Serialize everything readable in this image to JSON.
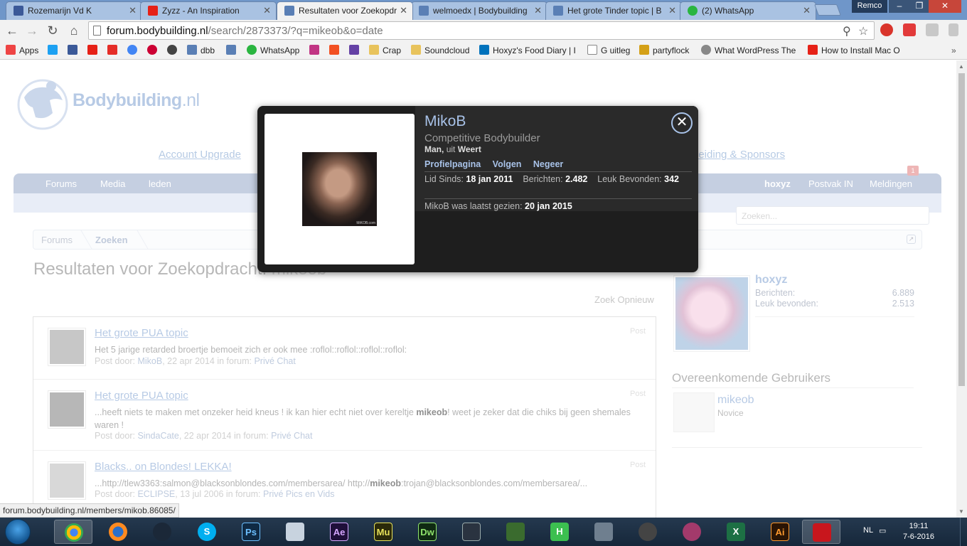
{
  "browser": {
    "tabs": [
      {
        "title": "Rozemarijn Vd K",
        "icon_color": "#3b5998",
        "active": false
      },
      {
        "title": "Zyzz - An Inspiration",
        "icon_color": "#e62117",
        "active": false
      },
      {
        "title": "Resultaten voor Zoekopdr",
        "icon_color": "#5a7fb5",
        "active": true
      },
      {
        "title": "welmoedx | Bodybuilding",
        "icon_color": "#5a7fb5",
        "active": false
      },
      {
        "title": "Het grote Tinder topic | B",
        "icon_color": "#5a7fb5",
        "active": false
      },
      {
        "title": "(2) WhatsApp",
        "icon_color": "#2ab540",
        "active": false
      }
    ],
    "window_user": "Remco",
    "url_host": "forum.bodybuilding.nl",
    "url_path": "/search/2873373/?q=mikeob&o=date",
    "bookmarks": [
      {
        "label": "Apps",
        "icon_color": "#e44"
      },
      {
        "label": "",
        "icon_color": "#1da1f2"
      },
      {
        "label": "",
        "icon_color": "#3b5998"
      },
      {
        "label": "",
        "icon_color": "#e62117"
      },
      {
        "label": "",
        "icon_color": "#e52d27"
      },
      {
        "label": "",
        "icon_color": "#4285f4"
      },
      {
        "label": "",
        "icon_color": "#c03"
      },
      {
        "label": "",
        "icon_color": "#444"
      },
      {
        "label": "dbb",
        "icon_color": "#5a7fb5"
      },
      {
        "label": "",
        "icon_color": "#5a7fb5"
      },
      {
        "label": "WhatsApp",
        "icon_color": "#2ab540"
      },
      {
        "label": "",
        "icon_color": "#c13584"
      },
      {
        "label": "",
        "icon_color": "#f25022"
      },
      {
        "label": "",
        "icon_color": "#6441a5"
      },
      {
        "label": "Crap",
        "icon_color": "#e8c35c"
      },
      {
        "label": "Soundcloud",
        "icon_color": "#e8c35c"
      },
      {
        "label": "Hoxyz's Food Diary | I",
        "icon_color": "#0072bc"
      },
      {
        "label": "G uitleg",
        "icon_color": "#ffffff"
      },
      {
        "label": "partyflock",
        "icon_color": "#d4a017"
      },
      {
        "label": "What WordPress The",
        "icon_color": "#888"
      },
      {
        "label": "How to Install Mac O",
        "icon_color": "#e62117"
      }
    ],
    "status_url": "forum.bodybuilding.nl/members/mikob.86085/"
  },
  "site": {
    "logo_text": "Bodybuilding",
    "logo_tld": ".nl",
    "top_links": [
      "Account Upgrade",
      "Leiding & Sponsors"
    ],
    "nav_left": [
      "Forums",
      "Media",
      "leden"
    ],
    "nav_right": [
      "hoxyz",
      "Postvak IN",
      "Meldingen"
    ],
    "notification_count": "1",
    "search_placeholder": "Zoeken...",
    "breadcrumb": [
      "Forums",
      "Zoeken"
    ],
    "page_title": "Resultaten voor Zoekopdracht:",
    "query": "mikeob",
    "search_again": "Zoek Opnieuw"
  },
  "results": [
    {
      "title": "Het grote PUA topic",
      "kind": "Post",
      "snippet_before": "Het 5 jarige retarded broertje bemoeit zich er ook mee :roflol::roflol::roflol::roflol:",
      "snippet_bold": "",
      "snippet_after": "",
      "meta_prefix": "Post door:",
      "author": "MikoB",
      "date": ", 22 apr 2014 in forum:",
      "forum": "Privé Chat",
      "avatar_color": "#9a9a9a"
    },
    {
      "title": "Het grote PUA topic",
      "kind": "Post",
      "snippet_before": "...heeft niets te maken met onzeker heid kneus ! ik kan hier echt niet over kereltje ",
      "snippet_bold": "mikeob",
      "snippet_after": "! weet je zeker dat die chiks bij geen shemales waren !",
      "meta_prefix": "Post door:",
      "author": "SindaCate",
      "date": ", 22 apr 2014 in forum:",
      "forum": "Privé Chat",
      "avatar_color": "#7d7d7d"
    },
    {
      "title": "Blacks.. on Blondes! LEKKA!",
      "kind": "Post",
      "snippet_before": "...http://tlew3363:salmon@blacksonblondes.com/membersarea/ http://",
      "snippet_bold": "mikeob",
      "snippet_after": ":trojan@blacksonblondes.com/membersarea/...",
      "meta_prefix": "Post door:",
      "author": "ECLIPSE",
      "date": ", 13 jul 2006 in forum:",
      "forum": "Privé Pics en Vids",
      "avatar_color": "#b9b9b9"
    }
  ],
  "sidebar": {
    "username": "hoxyz",
    "stats": [
      {
        "label": "Berichten:",
        "value": "6.889"
      },
      {
        "label": "Leuk bevonden:",
        "value": "2.513"
      }
    ],
    "similar_title": "Overeenkomende Gebruikers",
    "similar_user": {
      "name": "mikeob",
      "title": "Novice"
    }
  },
  "popup": {
    "name": "MikoB",
    "title": "Competitive Bodybuilder",
    "gender": "Man,",
    "from_label": "uit",
    "location": "Weert",
    "links": [
      "Profielpagina",
      "Volgen",
      "Negeer"
    ],
    "member_since_label": "Lid Sinds:",
    "member_since": "18 jan 2011",
    "posts_label": "Berichten:",
    "posts": "2.482",
    "likes_label": "Leuk Bevonden:",
    "likes": "342",
    "last_seen_label": "MikoB was laatst gezien:",
    "last_seen": "20 jan 2015",
    "photo_tag": "MiKOB.com"
  },
  "taskbar": {
    "language": "NL",
    "time": "19:11",
    "date": "7-6-2016"
  }
}
